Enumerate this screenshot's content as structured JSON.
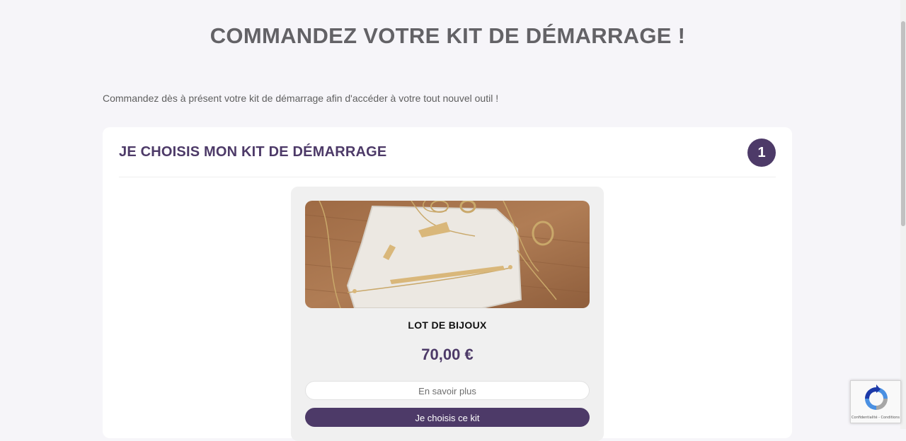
{
  "page": {
    "title": "COMMANDEZ VOTRE KIT DE DÉMARRAGE !",
    "intro": "Commandez dès à présent votre kit de démarrage afin d'accéder à votre tout nouvel outil !"
  },
  "step": {
    "title": "JE CHOISIS MON KIT DE DÉMARRAGE",
    "number": "1"
  },
  "kit": {
    "name": "LOT DE BIJOUX",
    "price": "70,00 €",
    "more_label": "En savoir plus",
    "choose_label": "Je choisis ce kit",
    "image_icon": "jewelry-photo"
  },
  "recaptcha": {
    "links": "Confidentialité - Conditions"
  },
  "colors": {
    "accent": "#4d3a68",
    "background": "#f6f5f9",
    "card": "#ffffff",
    "kit_card": "#f0f0f0"
  }
}
